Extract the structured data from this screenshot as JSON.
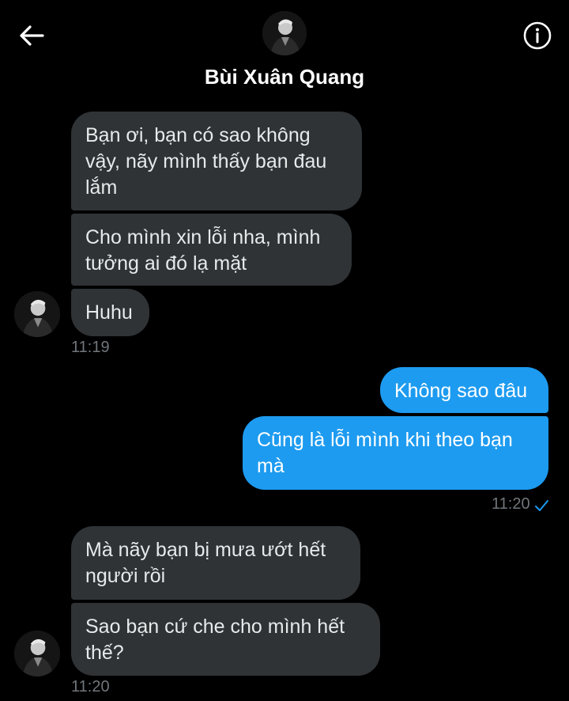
{
  "header": {
    "contact_name": "Bùi Xuân Quang",
    "back_icon": "arrow-left-icon",
    "info_icon": "info-icon"
  },
  "colors": {
    "background": "#000000",
    "incoming_bubble": "#2f3336",
    "outgoing_bubble": "#1d9bf0",
    "timestamp": "#71767b",
    "read_check": "#1d9bf0"
  },
  "messages": {
    "group1": {
      "m1": "Bạn ơi, bạn có sao không vậy, nãy mình thấy bạn đau lắm",
      "m2": "Cho mình xin lỗi nha, mình tưởng ai đó lạ mặt",
      "m3": "Huhu",
      "time": "11:19"
    },
    "group2": {
      "m1": "Không sao đâu",
      "m2": "Cũng là lỗi mình khi theo bạn mà",
      "time": "11:20",
      "status_icon": "check-icon"
    },
    "group3": {
      "m1": "Mà nãy bạn bị mưa ướt hết người rồi",
      "m2": "Sao bạn cứ che cho mình hết thế?",
      "time": "11:20"
    }
  }
}
